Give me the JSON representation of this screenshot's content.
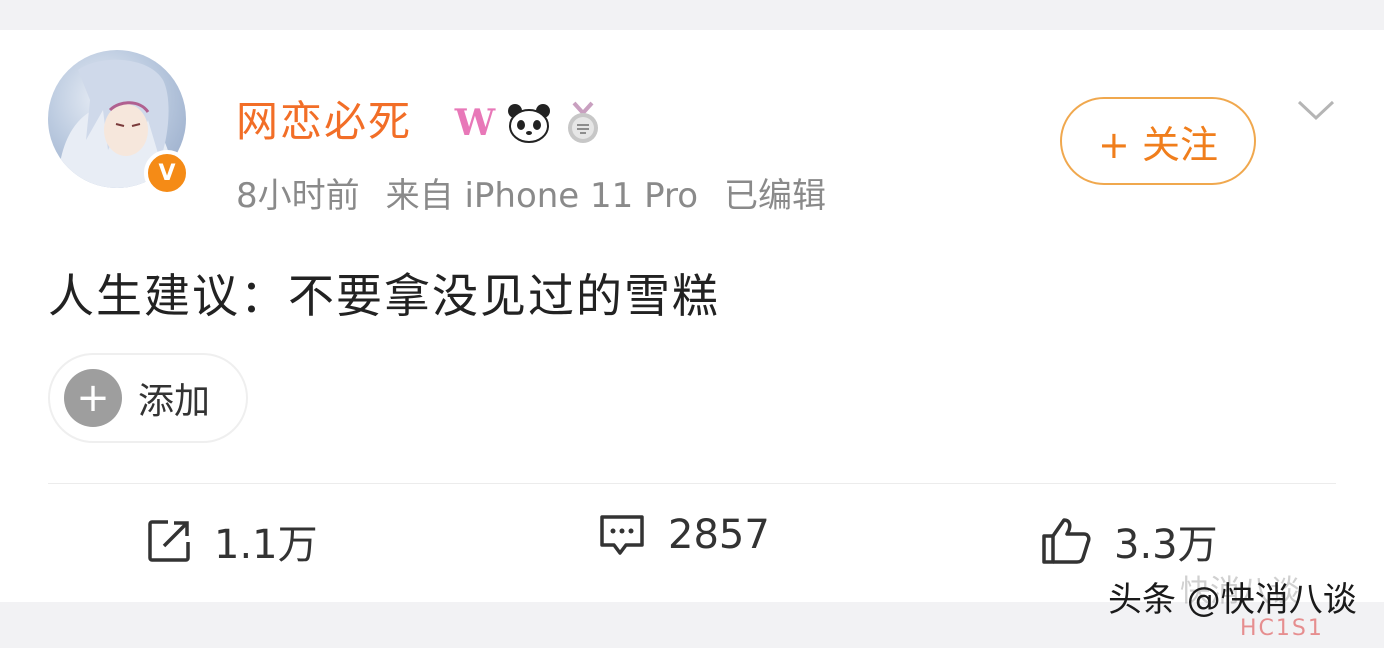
{
  "post": {
    "username": "网恋必死",
    "badges": [
      "vip-w-icon",
      "panda-icon",
      "medal-icon"
    ],
    "time": "8小时前",
    "source": "来自 iPhone 11 Pro",
    "edited": "已编辑",
    "follow_label": "+ 关注",
    "text": "人生建议：不要拿没见过的雪糕",
    "add_label": "添加"
  },
  "actions": {
    "repost": "1.1万",
    "comments": "2857",
    "likes": "3.3万"
  },
  "watermark": {
    "main": "头条 @快消八谈",
    "overlay": "快消八谈",
    "small": "HC1S1"
  },
  "colors": {
    "username": "#f26e27",
    "follow": "#f07e1c",
    "verified": "#f58b16"
  }
}
